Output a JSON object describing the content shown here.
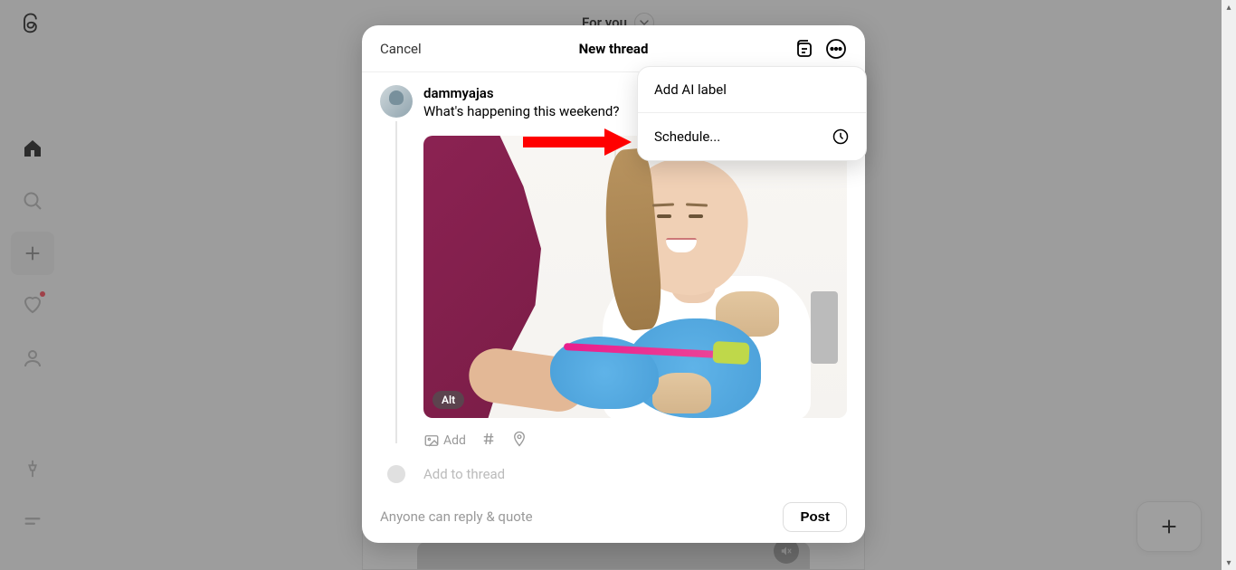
{
  "header": {
    "feed_title": "For you"
  },
  "composer": {
    "cancel_label": "Cancel",
    "title": "New thread",
    "username": "dammyajas",
    "text": "What's happening this weekend?",
    "alt_badge": "Alt",
    "add_label": "Add",
    "add_to_thread": "Add to thread",
    "reply_setting": "Anyone can reply & quote",
    "post_label": "Post"
  },
  "dropdown": {
    "items": [
      {
        "label": "Add AI label"
      },
      {
        "label": "Schedule..."
      }
    ]
  }
}
